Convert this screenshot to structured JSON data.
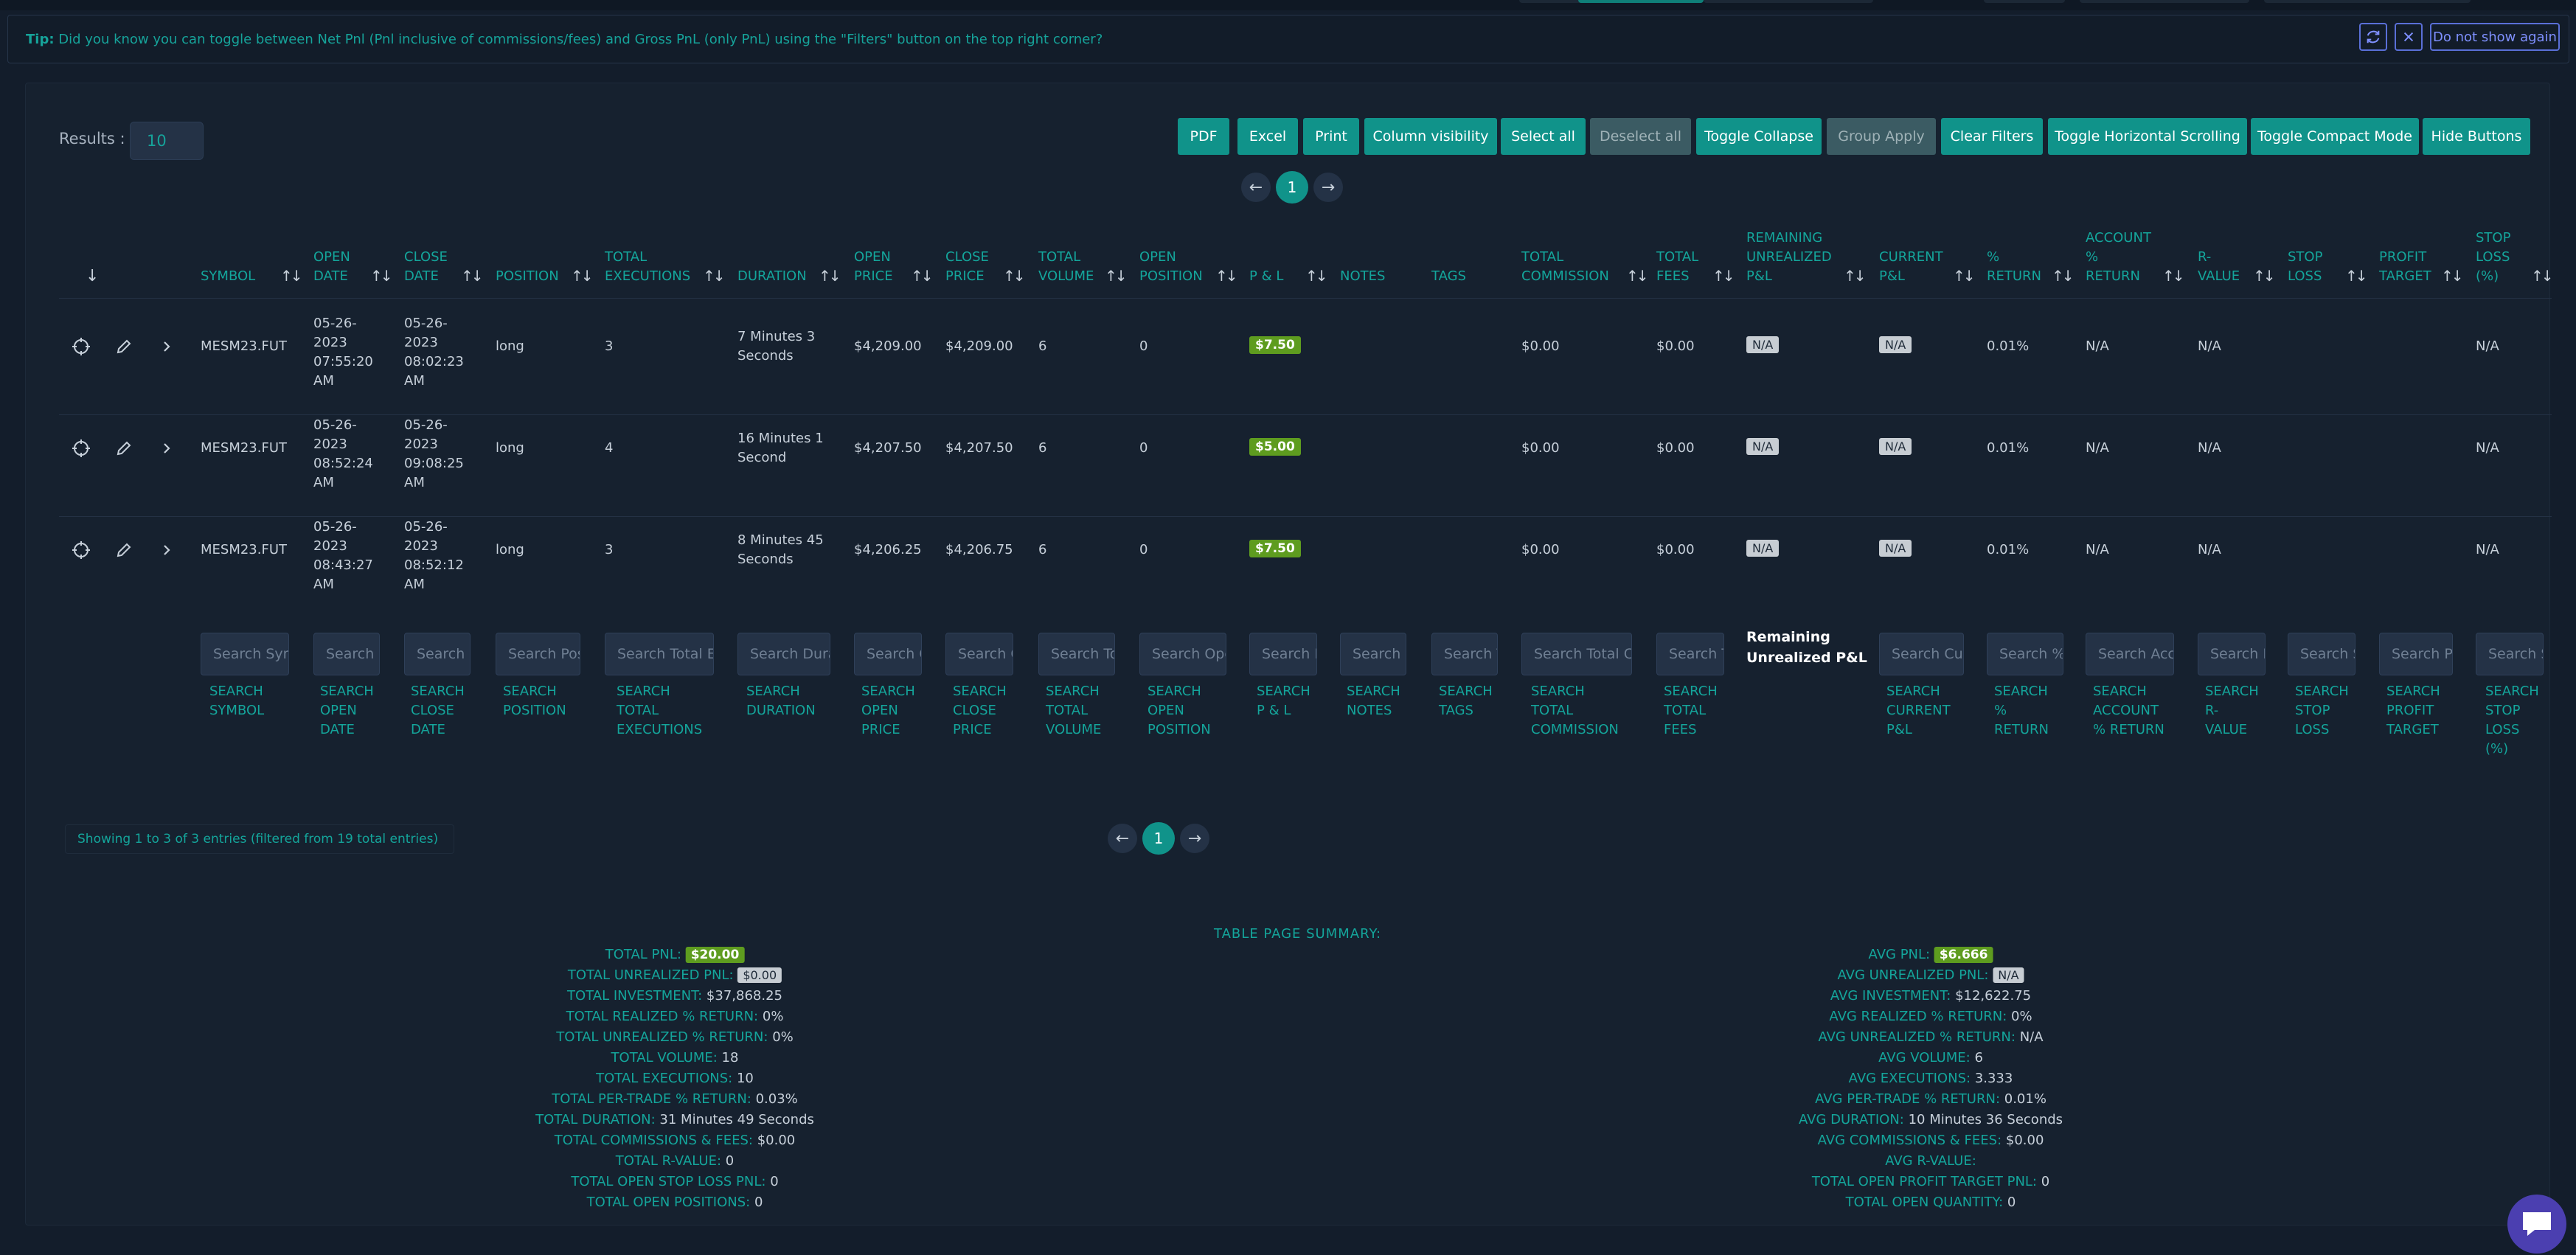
{
  "tip": {
    "prefix": "Tip:",
    "text": "Did you know you can toggle between Net Pnl (Pnl inclusive of commissions/fees) and Gross PnL (only PnL) using the \"Filters\" button on the top right corner?",
    "dismiss_label": "Do not show again",
    "refresh_icon": "refresh-icon",
    "close_icon": "close-icon"
  },
  "results": {
    "label": "Results :",
    "value": "10"
  },
  "toolbar": {
    "pdf": "PDF",
    "excel": "Excel",
    "print": "Print",
    "column_visibility": "Column visibility",
    "select_all": "Select all",
    "deselect_all": "Deselect all",
    "toggle_collapse": "Toggle Collapse",
    "group_apply": "Group Apply",
    "clear_filters": "Clear Filters",
    "toggle_horizontal": "Toggle Horizontal Scrolling",
    "toggle_compact": "Toggle Compact Mode",
    "hide_buttons": "Hide Buttons"
  },
  "pager": {
    "page": "1",
    "prev": "←",
    "next": "→"
  },
  "columns": {
    "expand": "↓",
    "symbol": "SYMBOL",
    "open_date_1": "OPEN",
    "open_date_2": "DATE",
    "close_date_1": "CLOSE",
    "close_date_2": "DATE",
    "position": "POSITION",
    "total_executions_1": "TOTAL",
    "total_executions_2": "EXECUTIONS",
    "duration": "DURATION",
    "open_price_1": "OPEN",
    "open_price_2": "PRICE",
    "close_price_1": "CLOSE",
    "close_price_2": "PRICE",
    "total_volume_1": "TOTAL",
    "total_volume_2": "VOLUME",
    "open_position_1": "OPEN",
    "open_position_2": "POSITION",
    "pnl": "P & L",
    "notes": "NOTES",
    "tags": "TAGS",
    "total_commission_1": "TOTAL",
    "total_commission_2": "COMMISSION",
    "total_fees_1": "TOTAL",
    "total_fees_2": "FEES",
    "remaining_1": "REMAINING",
    "remaining_2": "UNREALIZED",
    "remaining_3": "P&L",
    "current_pnl_1": "CURRENT",
    "current_pnl_2": "P&L",
    "pct_return_1": "%",
    "pct_return_2": "RETURN",
    "account_return_1": "ACCOUNT",
    "account_return_2": "%",
    "account_return_3": "RETURN",
    "r_value_1": "R-",
    "r_value_2": "VALUE",
    "stop_loss_1": "STOP",
    "stop_loss_2": "LOSS",
    "profit_target_1": "PROFIT",
    "profit_target_2": "TARGET",
    "stop_loss_pct_1": "STOP",
    "stop_loss_pct_2": "LOSS",
    "stop_loss_pct_3": "(%)"
  },
  "rows": [
    {
      "symbol": "MESM23.FUT",
      "open_date": [
        "05-26-",
        "2023",
        "07:55:20",
        "AM"
      ],
      "close_date": [
        "05-26-",
        "2023",
        "08:02:23",
        "AM"
      ],
      "position": "long",
      "executions": "3",
      "duration": [
        "7 Minutes 3",
        "Seconds"
      ],
      "open_price": "$4,209.00",
      "close_price": "$4,209.00",
      "volume": "6",
      "open_position": "0",
      "pnl": "$7.50",
      "commission": "$0.00",
      "fees": "$0.00",
      "remaining": "N/A",
      "current": "N/A",
      "pct_return": "0.01%",
      "account_return": "N/A",
      "r_value": "N/A",
      "stop_loss_pct": "N/A"
    },
    {
      "symbol": "MESM23.FUT",
      "open_date": [
        "05-26-",
        "2023",
        "08:52:24",
        "AM"
      ],
      "close_date": [
        "05-26-",
        "2023",
        "09:08:25",
        "AM"
      ],
      "position": "long",
      "executions": "4",
      "duration": [
        "16 Minutes 1",
        "Second"
      ],
      "open_price": "$4,207.50",
      "close_price": "$4,207.50",
      "volume": "6",
      "open_position": "0",
      "pnl": "$5.00",
      "commission": "$0.00",
      "fees": "$0.00",
      "remaining": "N/A",
      "current": "N/A",
      "pct_return": "0.01%",
      "account_return": "N/A",
      "r_value": "N/A",
      "stop_loss_pct": "N/A"
    },
    {
      "symbol": "MESM23.FUT",
      "open_date": [
        "05-26-",
        "2023",
        "08:43:27",
        "AM"
      ],
      "close_date": [
        "05-26-",
        "2023",
        "08:52:12",
        "AM"
      ],
      "position": "long",
      "executions": "3",
      "duration": [
        "8 Minutes 45",
        "Seconds"
      ],
      "open_price": "$4,206.25",
      "close_price": "$4,206.75",
      "volume": "6",
      "open_position": "0",
      "pnl": "$7.50",
      "commission": "$0.00",
      "fees": "$0.00",
      "remaining": "N/A",
      "current": "N/A",
      "pct_return": "0.01%",
      "account_return": "N/A",
      "r_value": "N/A",
      "stop_loss_pct": "N/A"
    }
  ],
  "search": {
    "symbol_ph": "Search Symbol",
    "open_date_ph": "Search Open Date",
    "close_date_ph": "Search Close Date",
    "position_ph": "Search Position",
    "executions_ph": "Search Total Executions",
    "duration_ph": "Search Duration",
    "open_price_ph": "Search Open Price",
    "close_price_ph": "Search Close Price",
    "volume_ph": "Search Total Volume",
    "open_position_ph": "Search Open Position",
    "pnl_ph": "Search P & L",
    "notes_ph": "Search Notes",
    "tags_ph": "Search Tags",
    "commission_ph": "Search Total Commission",
    "fees_ph": "Search Total Fees",
    "current_ph": "Search Current P&L",
    "pct_return_ph": "Search % Return",
    "account_return_ph": "Search Account % Return",
    "r_value_ph": "Search R-Value",
    "stop_loss_ph": "Search Stop Loss",
    "profit_target_ph": "Search Profit Target",
    "stop_loss_pct_ph": "Search Stop Loss (%)",
    "remaining_1": "Remaining",
    "remaining_2": "Unrealized P&L",
    "lbl_search": "SEARCH",
    "lbl_symbol": "SYMBOL",
    "lbl_open": "OPEN",
    "lbl_date": "DATE",
    "lbl_close": "CLOSE",
    "lbl_position": "POSITION",
    "lbl_total": "TOTAL",
    "lbl_executions": "EXECUTIONS",
    "lbl_duration": "DURATION",
    "lbl_price": "PRICE",
    "lbl_volume": "VOLUME",
    "lbl_pnl": "P & L",
    "lbl_notes": "NOTES",
    "lbl_tags": "TAGS",
    "lbl_commission": "COMMISSION",
    "lbl_fees": "FEES",
    "lbl_current": "CURRENT",
    "lbl_pl": "P&L",
    "lbl_pct": "%",
    "lbl_return": "RETURN",
    "lbl_account": "ACCOUNT",
    "lbl_pct_return": "% RETURN",
    "lbl_r": "R-",
    "lbl_value": "VALUE",
    "lbl_stop": "STOP",
    "lbl_loss": "LOSS",
    "lbl_profit": "PROFIT",
    "lbl_target": "TARGET",
    "lbl_pct_paren": "(%)"
  },
  "showing": "Showing 1 to 3 of 3 entries (filtered from 19 total entries)",
  "summary": {
    "title": "TABLE PAGE SUMMARY:",
    "left": [
      {
        "label": "TOTAL PNL:",
        "value": "$20.00",
        "kind": "badge"
      },
      {
        "label": "TOTAL UNREALIZED PNL:",
        "value": "$0.00",
        "kind": "na"
      },
      {
        "label": "TOTAL INVESTMENT:",
        "value": "$37,868.25",
        "kind": "text"
      },
      {
        "label": "TOTAL REALIZED % RETURN:",
        "value": "0%",
        "kind": "text"
      },
      {
        "label": "TOTAL UNREALIZED % RETURN:",
        "value": "0%",
        "kind": "text"
      },
      {
        "label": "TOTAL VOLUME:",
        "value": "18",
        "kind": "text"
      },
      {
        "label": "TOTAL EXECUTIONS:",
        "value": "10",
        "kind": "text"
      },
      {
        "label": "TOTAL PER-TRADE % RETURN:",
        "value": "0.03%",
        "kind": "text"
      },
      {
        "label": "TOTAL DURATION:",
        "value": "31 Minutes 49 Seconds",
        "kind": "text"
      },
      {
        "label": "TOTAL COMMISSIONS & FEES:",
        "value": "$0.00",
        "kind": "text"
      },
      {
        "label": "TOTAL R-VALUE:",
        "value": "0",
        "kind": "text"
      },
      {
        "label": "TOTAL OPEN STOP LOSS PNL:",
        "value": "0",
        "kind": "text"
      },
      {
        "label": "TOTAL OPEN POSITIONS:",
        "value": "0",
        "kind": "text"
      }
    ],
    "right": [
      {
        "label": "AVG PNL:",
        "value": "$6.666",
        "kind": "badge"
      },
      {
        "label": "AVG UNREALIZED PNL:",
        "value": "N/A",
        "kind": "na"
      },
      {
        "label": "AVG INVESTMENT:",
        "value": "$12,622.75",
        "kind": "text"
      },
      {
        "label": "AVG REALIZED % RETURN:",
        "value": "0%",
        "kind": "text"
      },
      {
        "label": "AVG UNREALIZED % RETURN:",
        "value": "N/A",
        "kind": "text"
      },
      {
        "label": "AVG VOLUME:",
        "value": "6",
        "kind": "text"
      },
      {
        "label": "AVG EXECUTIONS:",
        "value": "3.333",
        "kind": "text"
      },
      {
        "label": "AVG PER-TRADE % RETURN:",
        "value": "0.01%",
        "kind": "text"
      },
      {
        "label": "AVG DURATION:",
        "value": "10 Minutes 36 Seconds",
        "kind": "text"
      },
      {
        "label": "AVG COMMISSIONS & FEES:",
        "value": "$0.00",
        "kind": "text"
      },
      {
        "label": "AVG R-VALUE:",
        "value": "",
        "kind": "text"
      },
      {
        "label": "TOTAL OPEN PROFIT TARGET PNL:",
        "value": "0",
        "kind": "text"
      },
      {
        "label": "TOTAL OPEN QUANTITY:",
        "value": "0",
        "kind": "text"
      }
    ]
  },
  "colors": {
    "accent": "#10938a",
    "text_accent": "#14a59b",
    "pnl_badge": "#5e9c1f",
    "background": "#131d2b"
  }
}
